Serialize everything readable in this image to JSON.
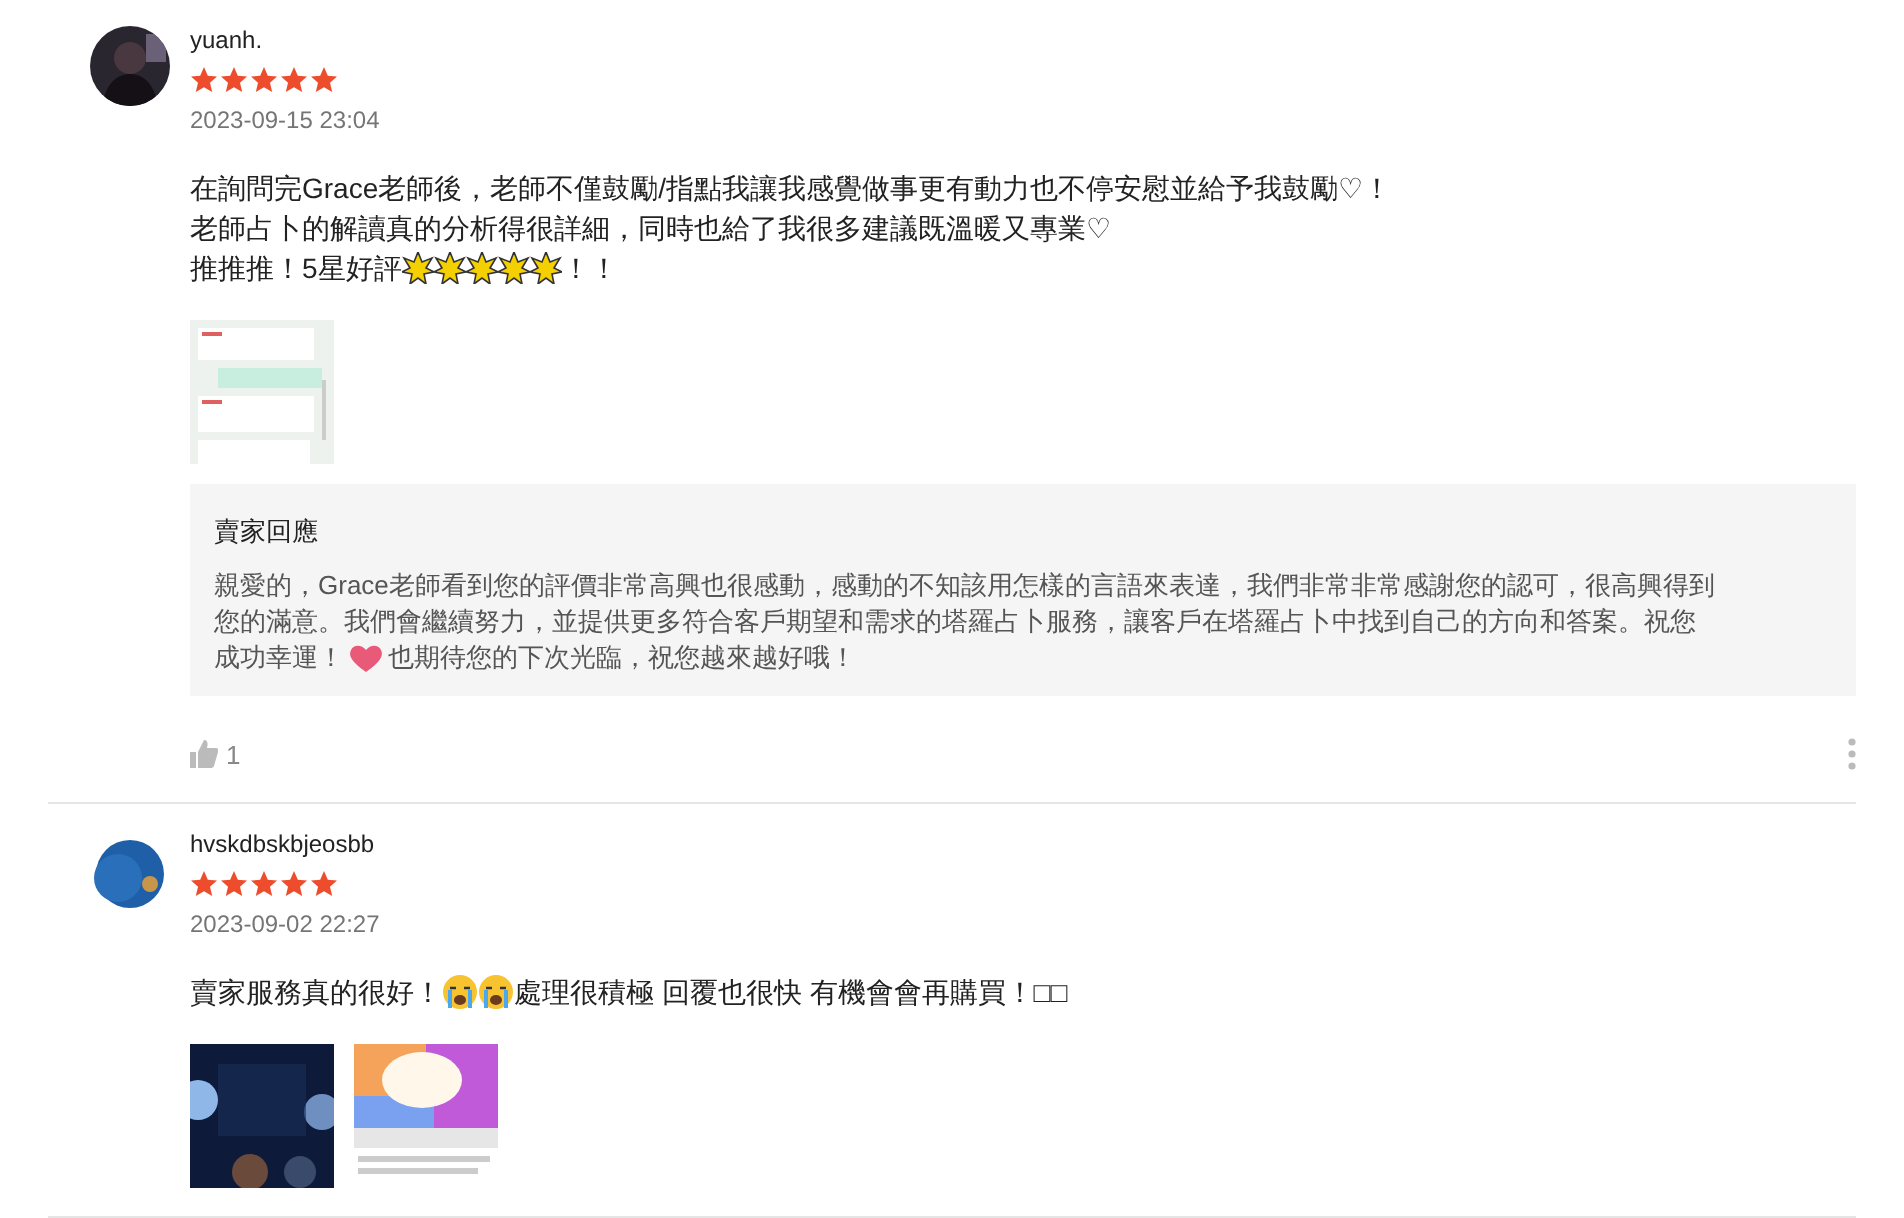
{
  "reviews": [
    {
      "username": "yuanh.",
      "stars": 5,
      "date": "2023-09-15 23:04",
      "lines": [
        [
          {
            "kind": "text",
            "text": "在詢問完Grace老師後，老師不僅鼓勵/指點我讓我感覺做事更有動力也不停安慰並給予我鼓勵♡！"
          }
        ],
        [
          {
            "kind": "text",
            "text": "老師占卜的解讀真的分析得很詳細，同時也給了我很多建議既溫暖又專業♡"
          }
        ],
        [
          {
            "kind": "text",
            "text": "推推推！5星好評"
          },
          {
            "kind": "star"
          },
          {
            "kind": "star"
          },
          {
            "kind": "star"
          },
          {
            "kind": "star"
          },
          {
            "kind": "star"
          },
          {
            "kind": "text",
            "text": "！！"
          }
        ]
      ],
      "images": [
        {
          "kind": "picture"
        }
      ],
      "reply": {
        "title": "賣家回應",
        "lines": [
          [
            {
              "kind": "text",
              "text": "親愛的，Grace老師看到您的評價非常高興也很感動，感動的不知該用怎樣的言語來表達，我們非常非常感謝您的認可，很高興得到"
            }
          ],
          [
            {
              "kind": "text",
              "text": "您的滿意。我們會繼續努力，並提供更多符合客戶期望和需求的塔羅占卜服務，讓客戶在塔羅占卜中找到自己的方向和答案。祝您"
            }
          ],
          [
            {
              "kind": "text",
              "text": "成功幸運！"
            },
            {
              "kind": "heart"
            },
            {
              "kind": "text",
              "text": "也期待您的下次光臨，祝您越來越好哦！"
            }
          ]
        ]
      },
      "likes": "1"
    },
    {
      "username": "hvskdbskbjeosbb",
      "stars": 5,
      "date": "2023-09-02 22:27",
      "lines": [
        [
          {
            "kind": "text",
            "text": "賣家服務真的很好！"
          },
          {
            "kind": "cry"
          },
          {
            "kind": "cry"
          },
          {
            "kind": "text",
            "text": "處理很積極 回覆也很快 有機會會再購買！□□"
          }
        ]
      ],
      "images": [
        {
          "kind": "picture"
        },
        {
          "kind": "picture"
        }
      ]
    }
  ]
}
